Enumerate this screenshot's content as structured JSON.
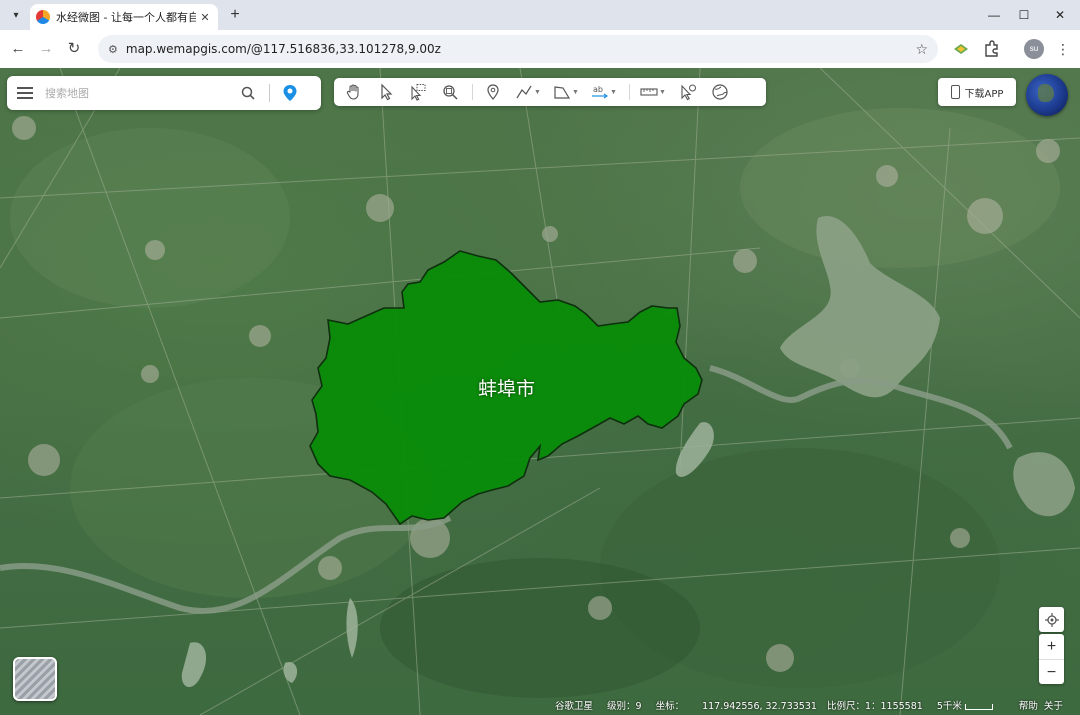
{
  "browser": {
    "tab_title": "水经微图 - 让每一个人都有自己",
    "tab_close": "✕",
    "new_tab": "+",
    "url": "map.wemapgis.com/@117.516836,33.101278,9.00z",
    "profile_initials": "su"
  },
  "search": {
    "placeholder": "搜索地图"
  },
  "toolbar": {
    "tools": [
      "hand-pan",
      "select-pointer",
      "box-select",
      "zoom-search",
      "place-marker",
      "draw-line",
      "draw-polygon",
      "text-label",
      "measure-ruler",
      "pointer-info",
      "globe"
    ]
  },
  "download_app": "下载APP",
  "map": {
    "city_label": "蚌埠市",
    "region_color": "#0a8c0a"
  },
  "status": {
    "source": "谷歌卫星",
    "level_label": "级别：",
    "level": "9",
    "coord_label": "坐标：",
    "coords": "117.942556, 32.733531",
    "scale_label": "比例尺：",
    "scale_value": "1：1155581",
    "distance": "5千米",
    "help": "帮助",
    "about": "关于"
  }
}
